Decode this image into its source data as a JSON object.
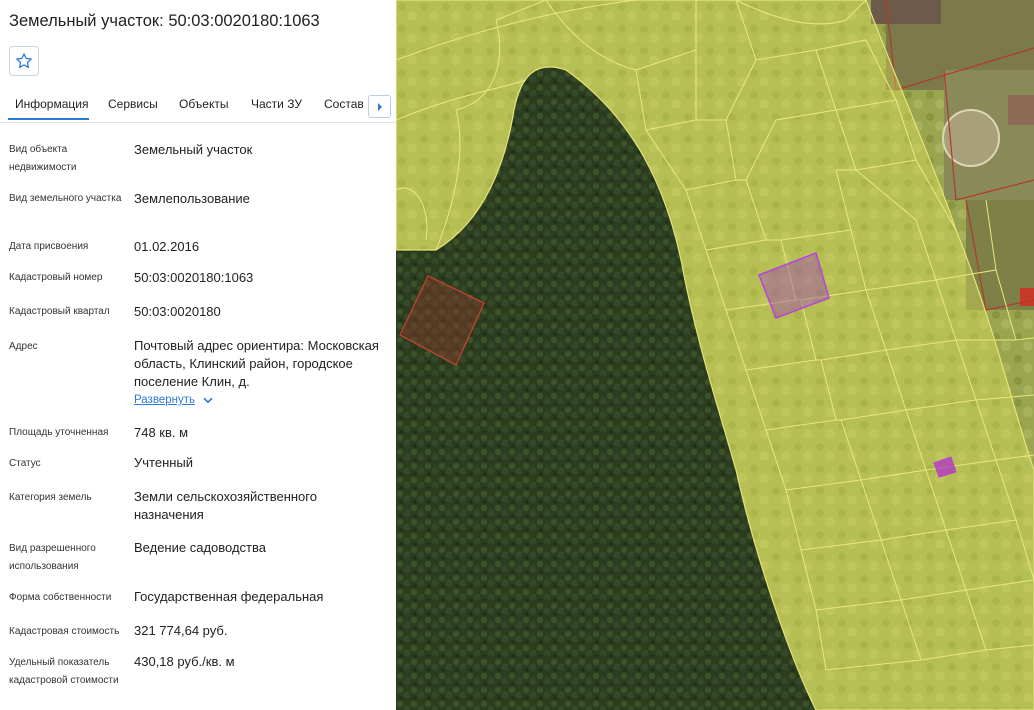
{
  "panel": {
    "title": "Земельный участок: 50:03:0020180:1063",
    "tabs": [
      "Информация",
      "Сервисы",
      "Объекты",
      "Части ЗУ",
      "Состав ЕЗП"
    ],
    "active_tab": 0,
    "fields": [
      {
        "label": "Вид объекта недвижимости",
        "value": "Земельный участок"
      },
      {
        "label": "Вид земельного участка",
        "value": "Землепользование"
      },
      {
        "label": "Дата присвоения",
        "value": "01.02.2016"
      },
      {
        "label": "Кадастровый номер",
        "value": "50:03:0020180:1063"
      },
      {
        "label": "Кадастровый квартал",
        "value": "50:03:0020180"
      },
      {
        "label": "Адрес",
        "value": "Почтовый адрес ориентира: Московская область, Клинский район, городское поселение Клин, д."
      },
      {
        "label": "Площадь уточненная",
        "value": "748 кв. м"
      },
      {
        "label": "Статус",
        "value": "Учтенный"
      },
      {
        "label": "Категория земель",
        "value": "Земли сельскохозяйственного назначения"
      },
      {
        "label": "Вид разрешенного использования",
        "value": "Ведение садоводства"
      },
      {
        "label": "Форма собственности",
        "value": "Государственная федеральная"
      },
      {
        "label": "Кадастровая стоимость",
        "value": "321 774,64 руб."
      },
      {
        "label": "Удельный показатель кадастровой стоимости",
        "value": "430,18 руб./кв. м"
      }
    ],
    "expand_label": "Развернуть",
    "icons": {
      "favorite": "star-icon",
      "next": "caret-right-icon",
      "expand": "chevron-down-icon"
    }
  },
  "map": {
    "colors": {
      "forest": "#2c3f1f",
      "field": "#8f9a46",
      "overlay": "#d8dc5a",
      "parcel_line": "#e8e27a",
      "selected": "#a03cbf",
      "other_parcel": "#b03a2a"
    }
  }
}
